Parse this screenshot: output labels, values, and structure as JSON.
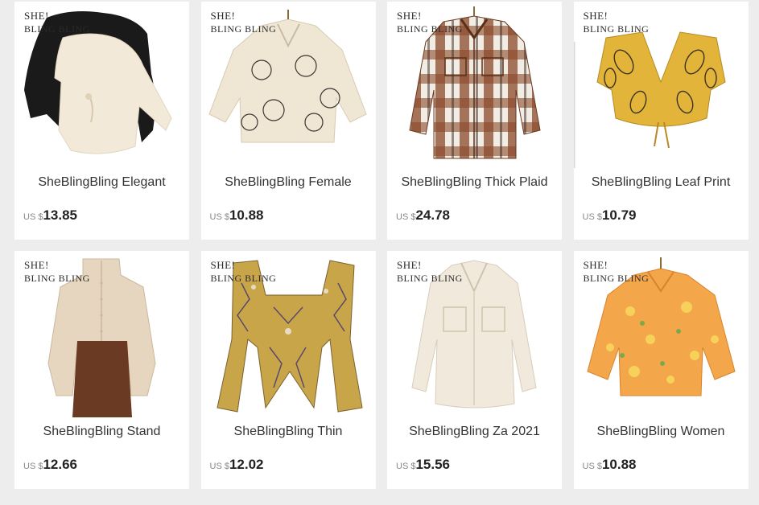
{
  "brand_watermark": {
    "line1": "SHE!",
    "line2": "BLING BLING"
  },
  "currency_prefix": "US $",
  "products": [
    {
      "title": "SheBlingBling Elegant",
      "price": "13.85",
      "icon": "black-cream-satin-blouses-image",
      "colors": [
        "#1a1a1a",
        "#f3e9d8"
      ]
    },
    {
      "title": "SheBlingBling Female",
      "price": "10.88",
      "icon": "face-print-cream-shirt-image",
      "colors": [
        "#efe6d4",
        "#3a3530"
      ]
    },
    {
      "title": "SheBlingBling Thick Plaid",
      "price": "24.78",
      "icon": "brown-plaid-shirt-jacket-image",
      "colors": [
        "#8a4a2a",
        "#f2ede4"
      ]
    },
    {
      "title": "SheBlingBling Leaf Print",
      "price": "10.79",
      "icon": "yellow-leaf-print-crop-top-image",
      "colors": [
        "#e3b43a",
        "#3b3320"
      ]
    },
    {
      "title": "SheBlingBling Stand",
      "price": "12.66",
      "icon": "beige-stand-collar-blouse-image",
      "colors": [
        "#e6d6bf",
        "#6b3a22"
      ]
    },
    {
      "title": "SheBlingBling Thin",
      "price": "12.02",
      "icon": "geometric-print-tie-crop-top-image",
      "colors": [
        "#c9a54a",
        "#5a4a6a"
      ]
    },
    {
      "title": "SheBlingBling Za 2021",
      "price": "15.56",
      "icon": "cream-pocket-long-shirt-image",
      "colors": [
        "#f1e9dc",
        "#d8cdbb"
      ]
    },
    {
      "title": "SheBlingBling Women",
      "price": "10.88",
      "icon": "orange-floral-crop-shirt-image",
      "colors": [
        "#f4a64a",
        "#f7d25a"
      ]
    }
  ]
}
